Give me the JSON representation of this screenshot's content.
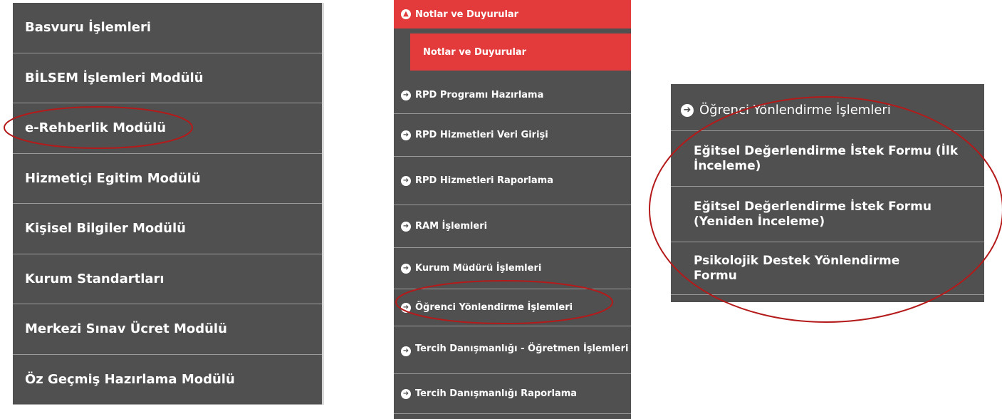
{
  "panel1": {
    "items": [
      "Basvuru İşlemleri",
      "BİLSEM İşlemleri Modülü",
      "e-Rehberlik Modülü",
      "Hizmetiçi Egitim Modülü",
      "Kişisel Bilgiler Modülü",
      "Kurum Standartları",
      "Merkezi Sınav Ücret Modülü",
      "Öz Geçmiş Hazırlama Modülü"
    ]
  },
  "panel2": {
    "top_item": "Notlar ve Duyurular",
    "sub_item": "Notlar ve Duyurular",
    "items": [
      "RPD Programı Hazırlama",
      "RPD Hizmetleri Veri Girişi",
      "RPD Hizmetleri Raporlama",
      "RAM İşlemleri",
      "Kurum Müdürü İşlemleri",
      "Öğrenci Yönlendirme İşlemleri",
      "Tercih Danışmanlığı - Öğretmen İşlemleri",
      "Tercih Danışmanlığı Raporlama"
    ]
  },
  "panel3": {
    "header": "Öğrenci Yönlendirme İşlemleri",
    "items": [
      "Eğitsel Değerlendirme İstek Formu (İlk İnceleme)",
      "Eğitsel Değerlendirme İstek Formu (Yeniden İnceleme)",
      "Psikolojik Destek Yönlendirme Formu"
    ]
  },
  "colors": {
    "menu_bg": "#505050",
    "active_bg": "#e33b3b",
    "annotation": "#b51a1a"
  }
}
